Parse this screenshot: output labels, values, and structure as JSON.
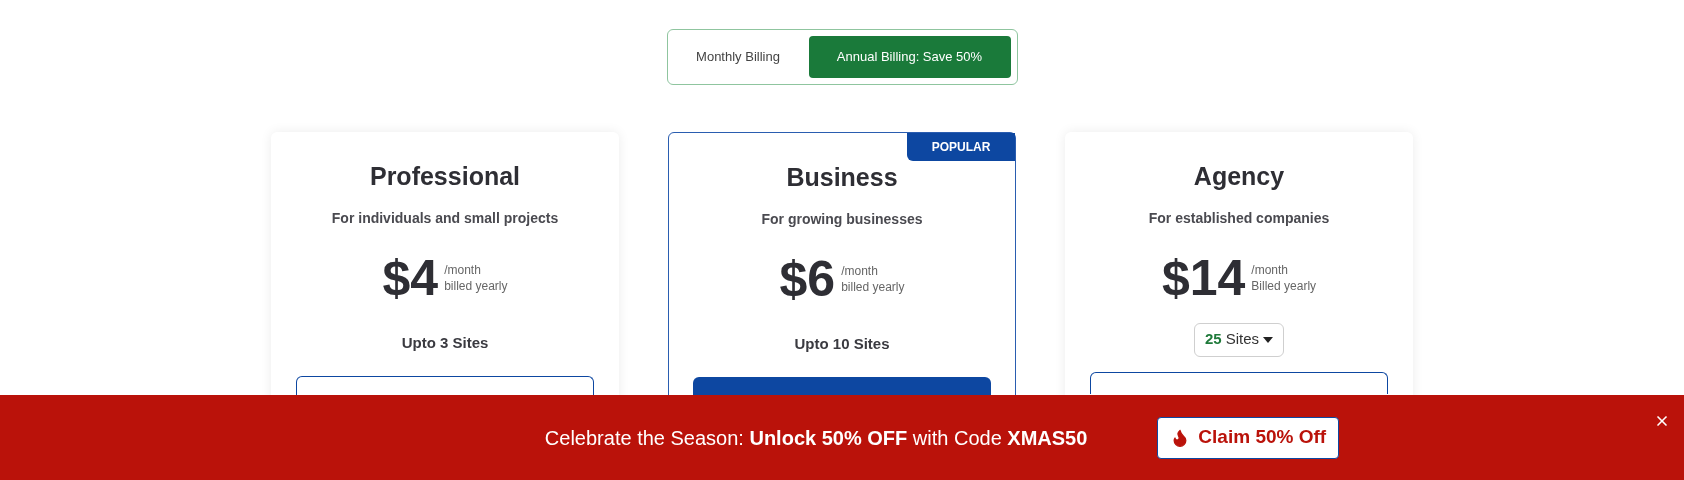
{
  "billing_toggle": [
    {
      "label": "Monthly Billing",
      "selected": false
    },
    {
      "label": "Annual Billing: Save 50%",
      "selected": true
    }
  ],
  "plans": [
    {
      "name": "Professional",
      "description": "For individuals and small projects",
      "price": "$4",
      "period": "/month",
      "billing_note": "billed yearly",
      "popular": false,
      "sites": {
        "kind": "text",
        "label": "Upto 3 Sites"
      }
    },
    {
      "name": "Business",
      "description": "For growing businesses",
      "price": "$6",
      "period": "/month",
      "billing_note": "billed yearly",
      "popular": true,
      "badge": "POPULAR",
      "sites": {
        "kind": "text",
        "label": "Upto 10 Sites"
      }
    },
    {
      "name": "Agency",
      "description": "For established companies",
      "price": "$14",
      "period": "/month",
      "billing_note": "Billed yearly",
      "popular": false,
      "sites": {
        "kind": "dropdown",
        "count": "25",
        "label": "Sites"
      }
    }
  ],
  "promo_banner": {
    "message": "Celebrate the Season: **Unlock 50% OFF** with Code **XMAS50**",
    "button": "Claim 50% Off"
  }
}
